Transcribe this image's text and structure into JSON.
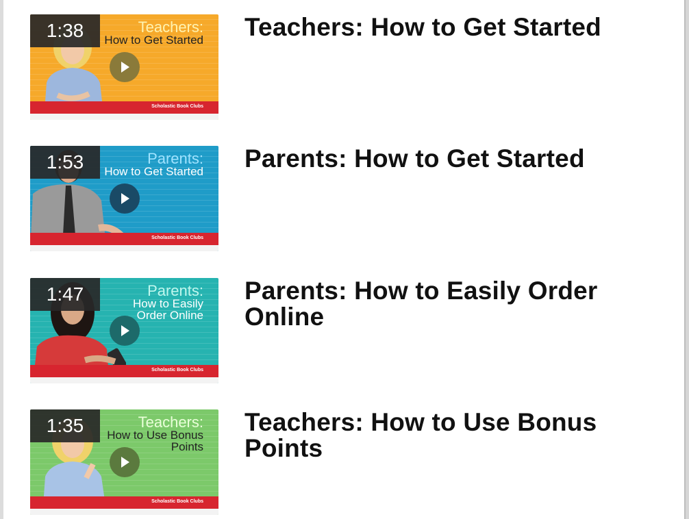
{
  "videos": [
    {
      "duration": "1:38",
      "title": "Teachers: How to Get Started",
      "thumb_heading": "Teachers:",
      "thumb_subtitle": "How to Get Started",
      "thumb_footer": "Scholastic Book Clubs",
      "thumb_color": "#f6a92a"
    },
    {
      "duration": "1:53",
      "title": "Parents: How to Get Started",
      "thumb_heading": "Parents:",
      "thumb_subtitle": "How to Get Started",
      "thumb_footer": "Scholastic Book Clubs",
      "thumb_color": "#1f9cc8"
    },
    {
      "duration": "1:47",
      "title": "Parents: How to Easily Order Online",
      "thumb_heading": "Parents:",
      "thumb_subtitle": "How to Easily Order Online",
      "thumb_footer": "Scholastic Book Clubs",
      "thumb_color": "#26b3b0"
    },
    {
      "duration": "1:35",
      "title": "Teachers: How to Use Bonus Points",
      "thumb_heading": "Teachers:",
      "thumb_subtitle": "How to Use Bonus Points",
      "thumb_footer": "Scholastic Book Clubs",
      "thumb_color": "#7cc96a"
    }
  ],
  "colors": {
    "duration_badge": "#282828",
    "title_text": "#111111",
    "footer_bar": "#d7252f"
  }
}
